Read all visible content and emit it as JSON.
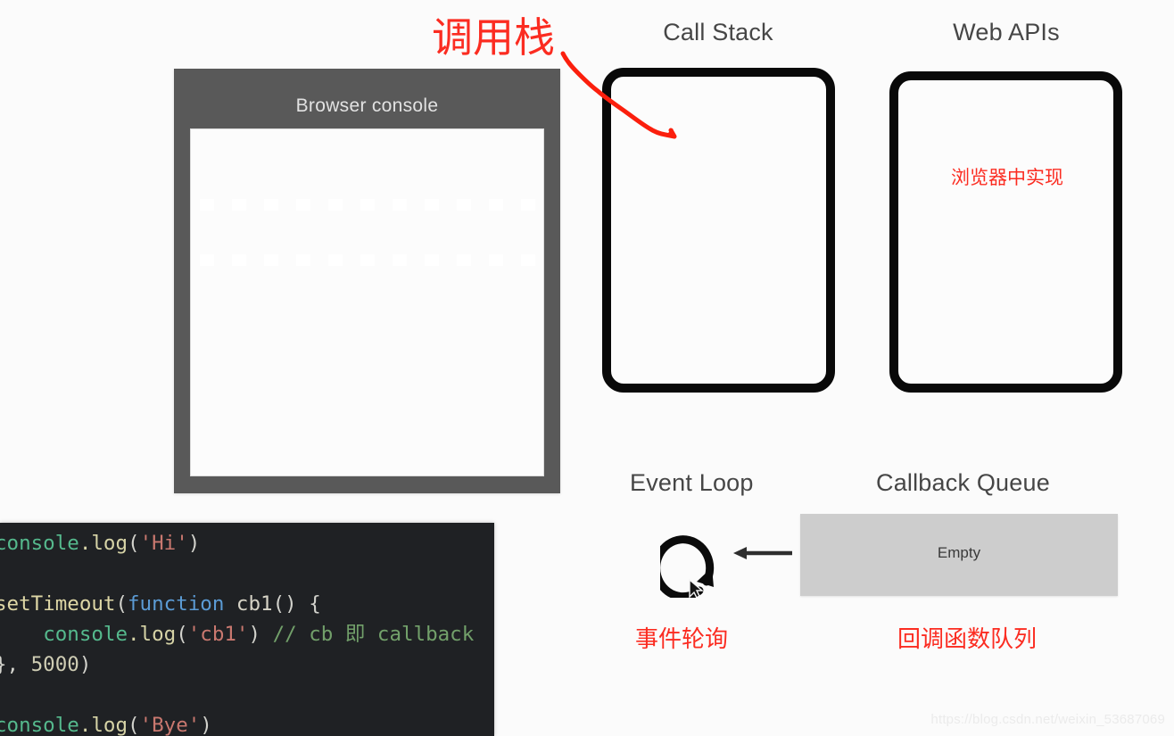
{
  "diagram": {
    "title_call_stack": "Call Stack",
    "title_web_apis": "Web APIs",
    "title_event_loop": "Event Loop",
    "title_callback_queue": "Callback Queue",
    "browser_console_title": "Browser console",
    "callback_queue_status": "Empty",
    "accent_red": "#fb2c21",
    "box_border_color": "#090909",
    "console_panel_color": "#595959",
    "queue_fill_color": "#cdcdcd"
  },
  "annotations": {
    "call_stack_cn": "调用栈",
    "web_apis_cn": "浏览器中实现",
    "event_loop_cn": "事件轮询",
    "callback_queue_cn": "回调函数队列"
  },
  "code": {
    "lines": [
      {
        "id": "line-1",
        "tokens": [
          {
            "t": "console",
            "c": "tok-obj"
          },
          {
            "t": ".log",
            "c": "tok-prop"
          },
          {
            "t": "(",
            "c": "tok-punc"
          },
          {
            "t": "'Hi'",
            "c": "tok-str"
          },
          {
            "t": ")",
            "c": "tok-punc"
          }
        ]
      },
      {
        "id": "line-2",
        "tokens": []
      },
      {
        "id": "line-3",
        "tokens": [
          {
            "t": "setTimeout",
            "c": "tok-fn"
          },
          {
            "t": "(",
            "c": "tok-punc"
          },
          {
            "t": "function",
            "c": "tok-kw"
          },
          {
            "t": " cb1",
            "c": "tok-plain"
          },
          {
            "t": "() {",
            "c": "tok-punc"
          }
        ]
      },
      {
        "id": "line-4",
        "tokens": [
          {
            "t": "    ",
            "c": "tok-plain"
          },
          {
            "t": "console",
            "c": "tok-obj"
          },
          {
            "t": ".log",
            "c": "tok-prop"
          },
          {
            "t": "(",
            "c": "tok-punc"
          },
          {
            "t": "'cb1'",
            "c": "tok-str"
          },
          {
            "t": ")",
            "c": "tok-punc"
          },
          {
            "t": " // cb 即 callback",
            "c": "tok-com"
          }
        ]
      },
      {
        "id": "line-5",
        "tokens": [
          {
            "t": "}, ",
            "c": "tok-punc"
          },
          {
            "t": "5000",
            "c": "tok-num"
          },
          {
            "t": ")",
            "c": "tok-punc"
          }
        ]
      },
      {
        "id": "line-6",
        "tokens": []
      },
      {
        "id": "line-7",
        "tokens": [
          {
            "t": "console",
            "c": "tok-obj"
          },
          {
            "t": ".log",
            "c": "tok-prop"
          },
          {
            "t": "(",
            "c": "tok-punc"
          },
          {
            "t": "'Bye'",
            "c": "tok-str"
          },
          {
            "t": ")",
            "c": "tok-punc"
          }
        ]
      }
    ]
  },
  "watermark": {
    "text": "https://blog.csdn.net/weixin_53687069"
  }
}
